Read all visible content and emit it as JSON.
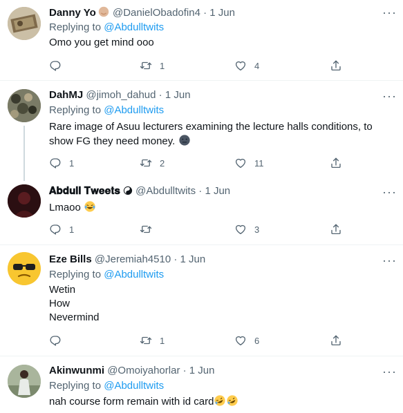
{
  "tweets": [
    {
      "name": "Danny Yo",
      "handle": "@DanielObadofin4",
      "date": "1 Jun",
      "replying_prefix": "Replying to",
      "replying_to": "@Abdulltwits",
      "text": "Omo you get mind ooo",
      "replies": "",
      "retweets": "1",
      "likes": "4"
    },
    {
      "name": "DahMJ",
      "handle": "@jimoh_dahud",
      "date": "1 Jun",
      "replying_prefix": "Replying to",
      "replying_to": "@Abdulltwits",
      "text_line1": "Rare image of Asuu lecturers examining the lecture halls conditions, to",
      "text_line2": "show FG they need money.",
      "replies": "1",
      "retweets": "2",
      "likes": "11"
    },
    {
      "name": "𝐀𝐛𝐝𝐮𝐥𝐥 𝐓𝐰𝐞𝐞𝐭𝐬",
      "handle": "@Abdulltwits",
      "date": "1 Jun",
      "text": "Lmaoo",
      "replies": "1",
      "retweets": "",
      "likes": "3"
    },
    {
      "name": "Eze Bills",
      "handle": "@Jeremiah4510",
      "date": "1 Jun",
      "replying_prefix": "Replying to",
      "replying_to": "@Abdulltwits",
      "text_lines": [
        "Wetin",
        "How",
        "Nevermind"
      ],
      "replies": "",
      "retweets": "1",
      "likes": "6"
    },
    {
      "name": "Akinwunmi",
      "handle": "@Omoiyahorlar",
      "date": "1 Jun",
      "replying_prefix": "Replying to",
      "replying_to": "@Abdulltwits",
      "text": "nah course form remain with id card"
    }
  ],
  "separator": "·",
  "more_label": "···",
  "colors": {
    "text": "#0f1419",
    "muted": "#536471",
    "link": "#1d9bf0",
    "divider": "#eff3f4"
  },
  "icons": [
    "reply-icon",
    "retweet-icon",
    "like-icon",
    "share-icon",
    "more-icon"
  ]
}
